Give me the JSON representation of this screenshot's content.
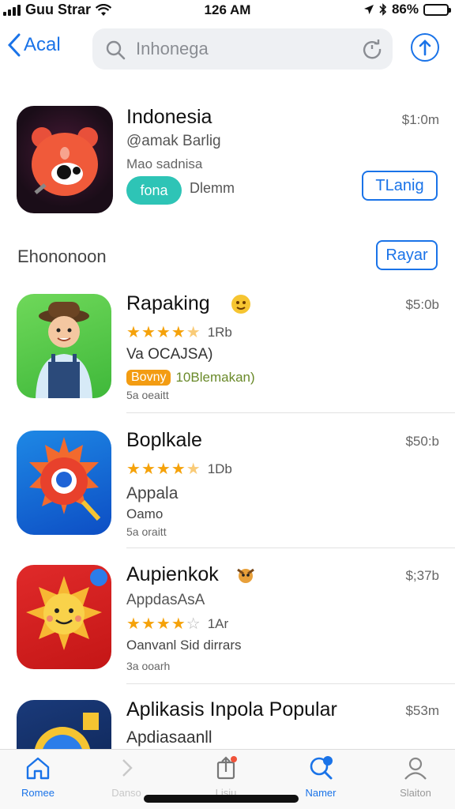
{
  "status": {
    "carrier": "Guu Strar",
    "time": "126 AM",
    "battery": "86%",
    "battery_level": 0.5
  },
  "nav": {
    "back_label": "Acal",
    "search_text": "Inhonega"
  },
  "featured": {
    "title": "Indonesia",
    "developer": "@amak Barlig",
    "subtitle": "Mao sadnisa",
    "chip": "fona",
    "chip_label": "Dlemm",
    "price": "$1:0m",
    "button": "TLanig"
  },
  "section": {
    "title": "Ehononoon",
    "button": "Rayar"
  },
  "apps": [
    {
      "title": "Rapaking",
      "rating_count": "1Rb",
      "rating": 4.5,
      "line3": "Va OCAJSA)",
      "tag": "Bovny",
      "tag_note": "10Blemakan)",
      "line5": "5a oeaitt",
      "price": "$5:0b"
    },
    {
      "title": "Boplkale",
      "rating_count": "1Db",
      "rating": 4.5,
      "line3": "Appala",
      "line4": "Oamo",
      "line5": "5a oraitt",
      "price": "$50:b"
    },
    {
      "title": "Aupienkok",
      "rating_count": "1Ar",
      "rating": 4.0,
      "line3": "AppdasAsA",
      "line4": "Oanvanl Sid dirrars",
      "line5": "3a ooarh",
      "price": "$;37b"
    },
    {
      "title": "Aplikasis Inpola Popular",
      "line3": "Apdiasaanll",
      "price": "$53m"
    }
  ],
  "tabs": [
    {
      "label": "Romee",
      "icon": "home-icon",
      "active": true
    },
    {
      "label": "Danso",
      "icon": "chevron-right-icon",
      "active": false
    },
    {
      "label": "Lisiu",
      "icon": "share-icon",
      "active": false
    },
    {
      "label": "Namer",
      "icon": "search-icon",
      "active": true
    },
    {
      "label": "Slaiton",
      "icon": "person-icon",
      "active": false
    }
  ],
  "colors": {
    "accent": "#1a73e8",
    "star": "#f5a20a",
    "chip": "#2ec4b6",
    "tag": "#f39c12"
  }
}
